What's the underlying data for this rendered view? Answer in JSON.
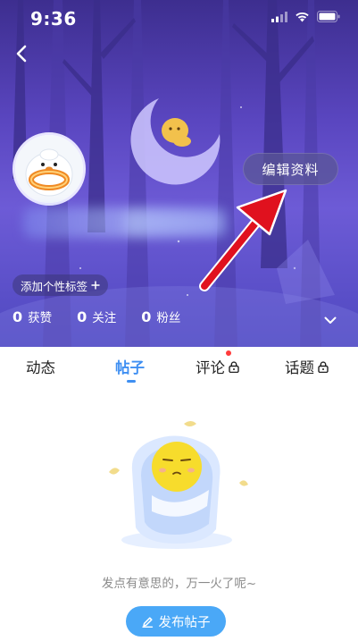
{
  "status_bar": {
    "time": "9:36",
    "icons": [
      "signal-icon",
      "wifi-icon",
      "battery-icon"
    ]
  },
  "header": {
    "back_icon": "chevron-left-icon",
    "edit_profile_label": "编辑资料",
    "add_tag_label": "添加个性标签",
    "add_tag_icon": "plus-icon",
    "expand_icon": "chevron-down-icon",
    "stats": [
      {
        "value": "0",
        "label": "获赞"
      },
      {
        "value": "0",
        "label": "关注"
      },
      {
        "value": "0",
        "label": "粉丝"
      }
    ]
  },
  "tabs": [
    {
      "label": "动态",
      "active": false,
      "locked": false
    },
    {
      "label": "帖子",
      "active": true,
      "locked": false
    },
    {
      "label": "评论",
      "active": false,
      "locked": true,
      "dot": true
    },
    {
      "label": "话题",
      "active": false,
      "locked": true
    }
  ],
  "empty_state": {
    "message": "发点有意思的，万一火了呢~",
    "post_button_label": "发布帖子",
    "post_button_icon": "pen-icon"
  },
  "colors": {
    "accent": "#3f8ff2",
    "button": "#4aa8f7",
    "banner_purple": "#5a46c0",
    "arrow_red": "#e0111e"
  }
}
